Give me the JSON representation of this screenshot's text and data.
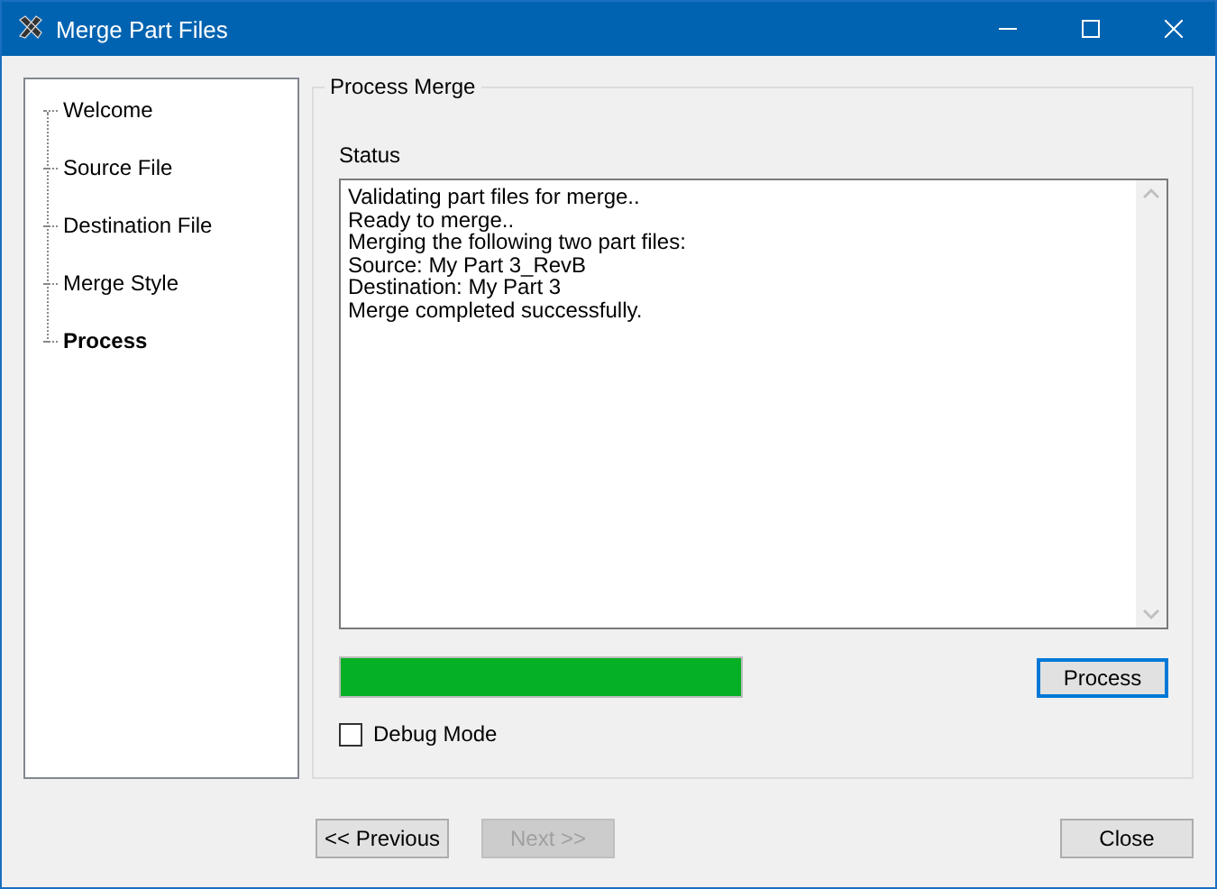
{
  "window": {
    "title": "Merge Part Files"
  },
  "steps": [
    {
      "label": "Welcome",
      "selected": false
    },
    {
      "label": "Source File",
      "selected": false
    },
    {
      "label": "Destination File",
      "selected": false
    },
    {
      "label": "Merge Style",
      "selected": false
    },
    {
      "label": "Process",
      "selected": true
    }
  ],
  "group": {
    "title": "Process Merge",
    "status_label": "Status",
    "status_lines": [
      "Validating part files for merge..",
      "Ready to merge..",
      "Merging the following two part files:",
      "Source: My Part 3_RevB",
      "Destination: My Part 3",
      "Merge completed successfully."
    ],
    "progress": {
      "level": 1
    },
    "process_button": "Process",
    "debug": {
      "label": "Debug Mode",
      "checked": false
    }
  },
  "buttons": [
    {
      "label": "<< Previous",
      "disabled": false,
      "kind": "previous"
    },
    {
      "label": "Next >>",
      "disabled": true,
      "kind": "next"
    },
    {
      "label": "Close",
      "disabled": false,
      "kind": "close"
    }
  ]
}
